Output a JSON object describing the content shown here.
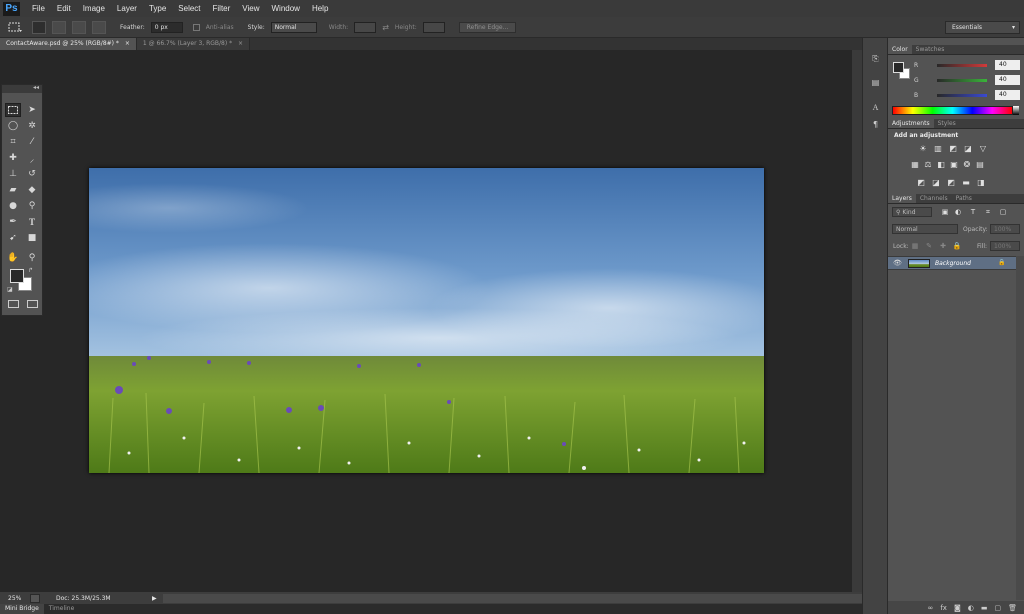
{
  "app": {
    "logo": "Ps"
  },
  "menu": [
    "File",
    "Edit",
    "Image",
    "Layer",
    "Type",
    "Select",
    "Filter",
    "View",
    "Window",
    "Help"
  ],
  "options": {
    "feather_label": "Feather:",
    "feather_value": "0 px",
    "antialias_label": "Anti-alias",
    "style_label": "Style:",
    "style_value": "Normal",
    "width_label": "Width:",
    "height_label": "Height:",
    "refine_label": "Refine Edge...",
    "workspace": "Essentials"
  },
  "tabs": [
    {
      "label": "ContactAware.psd @ 25% (RGB/8#) *",
      "close": "×"
    },
    {
      "label": "1 @ 66.7% (Layer 3, RGB/8) *",
      "close": "×"
    }
  ],
  "status": {
    "zoom": "25%",
    "doc": "Doc: 25.3M/25.3M"
  },
  "bottom_tabs": [
    "Mini Bridge",
    "Timeline"
  ],
  "color_panel": {
    "tabs": [
      "Color",
      "Swatches"
    ],
    "sliders": [
      {
        "letter": "R",
        "value": "40",
        "color": "#d23a3a"
      },
      {
        "letter": "G",
        "value": "40",
        "color": "#3ab43a"
      },
      {
        "letter": "B",
        "value": "40",
        "color": "#3a4ad2"
      }
    ]
  },
  "adjustments_panel": {
    "tabs": [
      "Adjustments",
      "Styles"
    ],
    "heading": "Add an adjustment"
  },
  "layers_panel": {
    "tabs": [
      "Layers",
      "Channels",
      "Paths"
    ],
    "kind_label": "Kind",
    "blend_mode": "Normal",
    "opacity_label": "Opacity:",
    "opacity_value": "100%",
    "lock_label": "Lock:",
    "fill_label": "Fill:",
    "fill_value": "100%",
    "layer_name": "Background"
  },
  "colors": {
    "accent": "#4aa8ff",
    "selected_layer": "#5f6f84"
  }
}
